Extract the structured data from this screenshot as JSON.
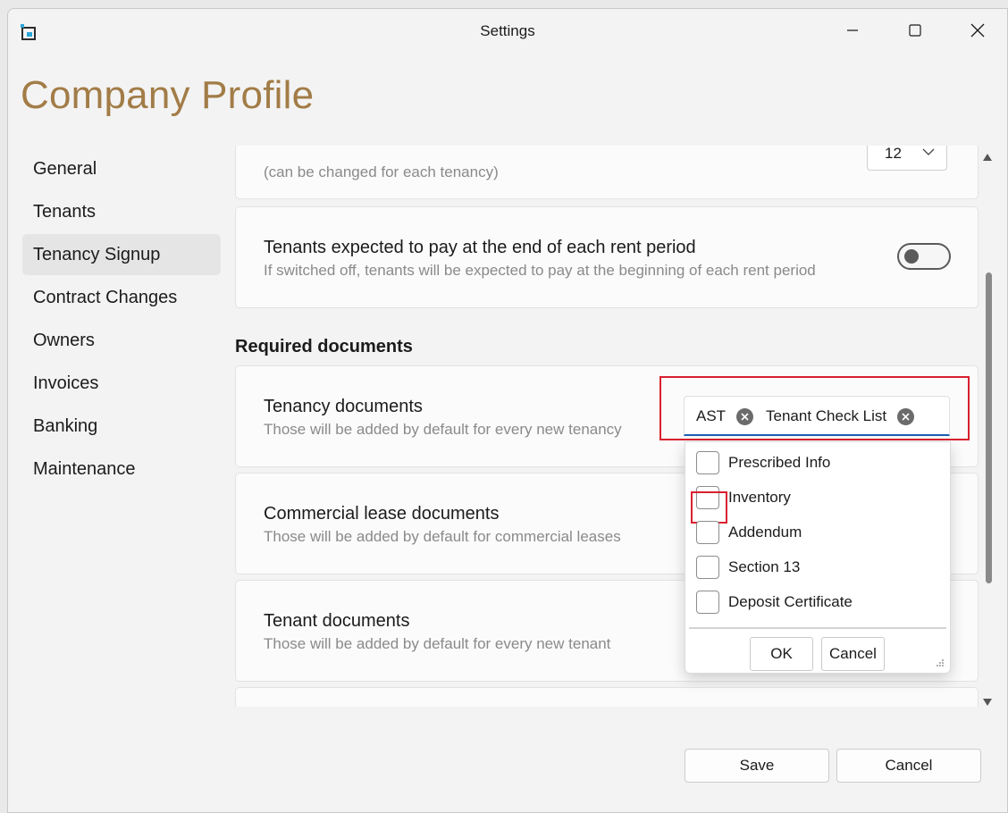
{
  "window": {
    "title": "Settings"
  },
  "page": {
    "title": "Company Profile"
  },
  "sidebar": {
    "items": [
      {
        "label": "General"
      },
      {
        "label": "Tenants"
      },
      {
        "label": "Tenancy Signup",
        "selected": true
      },
      {
        "label": "Contract Changes"
      },
      {
        "label": "Owners"
      },
      {
        "label": "Invoices"
      },
      {
        "label": "Banking"
      },
      {
        "label": "Maintenance"
      }
    ]
  },
  "settings": {
    "tenancy_length": {
      "subtitle": "(can be changed for each tenancy)",
      "value": "12"
    },
    "pay_end_of_period": {
      "title": "Tenants expected to pay at the end of each rent period",
      "subtitle": "If switched off, tenants will be expected to pay at the beginning of each rent period",
      "on": false
    },
    "required_documents_heading": "Required documents",
    "tenancy_documents": {
      "title": "Tenancy documents",
      "subtitle": "Those will be added by default for every new tenancy",
      "selected": [
        "AST",
        "Tenant Check List"
      ]
    },
    "commercial_lease_documents": {
      "title": "Commercial lease documents",
      "subtitle": "Those will be added by default for commercial leases"
    },
    "tenant_documents": {
      "title": "Tenant documents",
      "subtitle": "Those will be added by default for every new tenant"
    }
  },
  "dropdown": {
    "options": [
      {
        "label": "Prescribed Info",
        "checked": false
      },
      {
        "label": "Inventory",
        "checked": false
      },
      {
        "label": "Addendum",
        "checked": false
      },
      {
        "label": "Section 13",
        "checked": false
      },
      {
        "label": "Deposit Certificate",
        "checked": false
      }
    ],
    "ok_label": "OK",
    "cancel_label": "Cancel"
  },
  "footer": {
    "save_label": "Save",
    "cancel_label": "Cancel"
  },
  "colors": {
    "accent_title": "#a27c47",
    "highlight": "#d9202f",
    "focus_underline": "#1e5fb5"
  }
}
